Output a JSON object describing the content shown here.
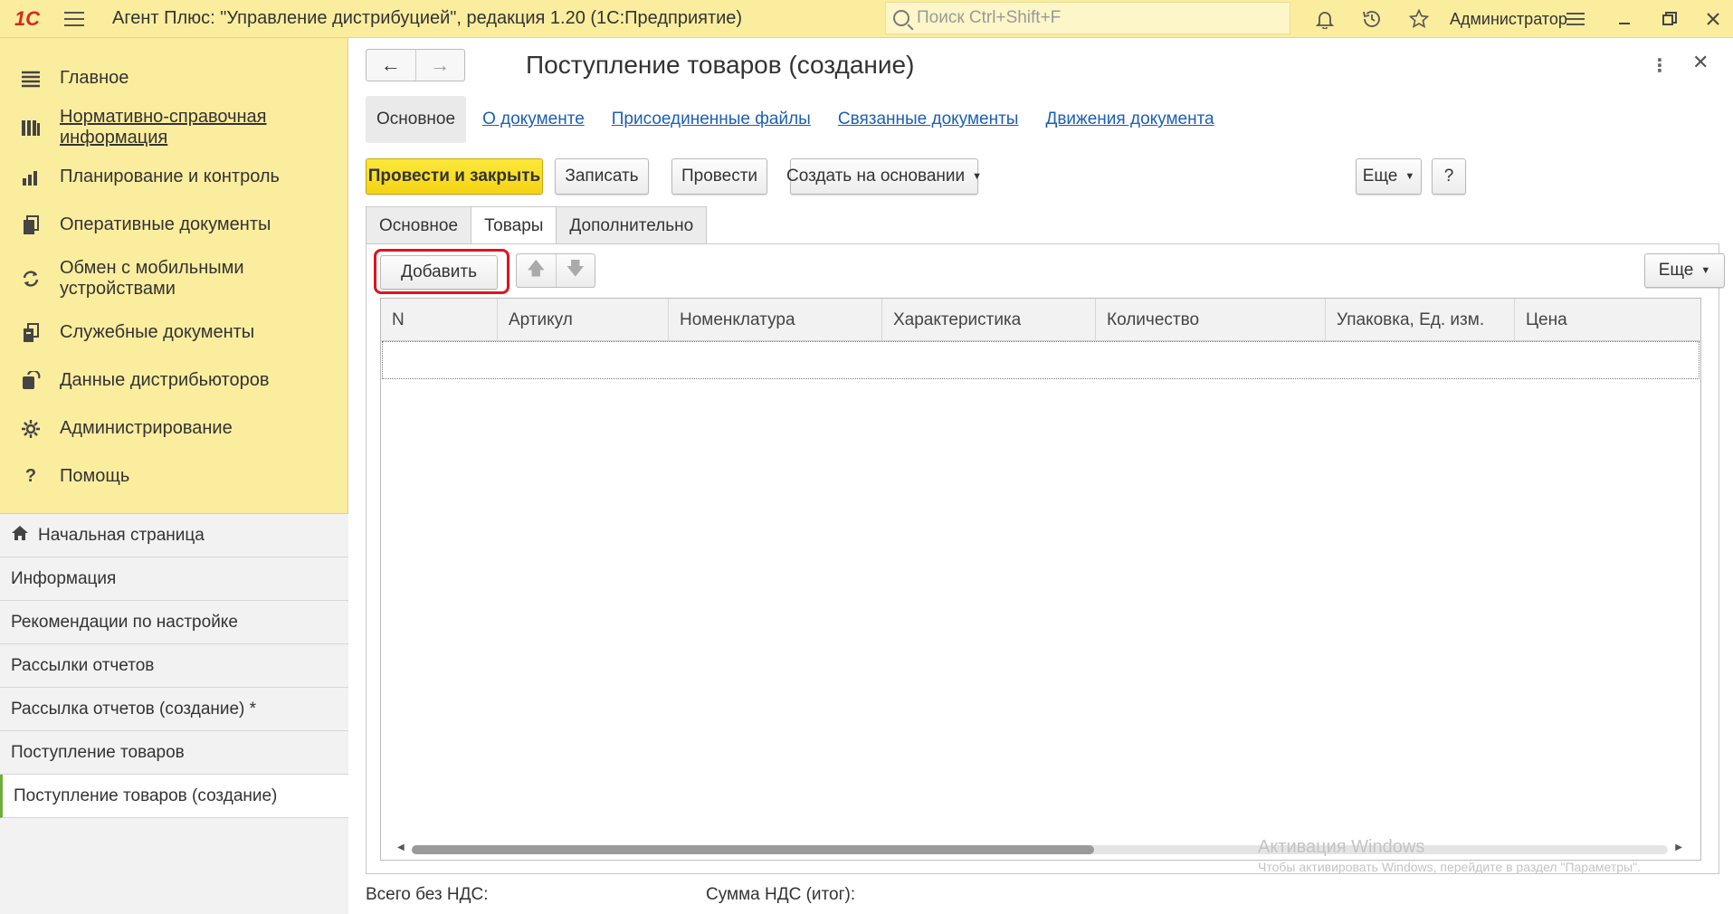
{
  "topbar": {
    "logo": "1С",
    "title": "Агент Плюс: \"Управление дистрибуцией\", редакция 1.20  (1С:Предприятие)",
    "search_placeholder": "Поиск Ctrl+Shift+F",
    "user": "Администратор"
  },
  "sidebar": {
    "items": [
      {
        "label": "Главное",
        "icon": "menu-lines-icon"
      },
      {
        "label": "Нормативно-справочная информация",
        "icon": "books-icon"
      },
      {
        "label": "Планирование и контроль",
        "icon": "bar-chart-icon"
      },
      {
        "label": "Оперативные документы",
        "icon": "documents-icon"
      },
      {
        "label": "Обмен с мобильными устройствами",
        "icon": "sync-icon"
      },
      {
        "label": "Служебные документы",
        "icon": "service-docs-icon"
      },
      {
        "label": "Данные дистрибьюторов",
        "icon": "distributor-data-icon"
      },
      {
        "label": "Администрирование",
        "icon": "gear-icon"
      },
      {
        "label": "Помощь",
        "icon": "question-icon"
      }
    ],
    "open_windows": [
      {
        "label": "Начальная страница",
        "icon": "home-icon"
      },
      {
        "label": "Информация"
      },
      {
        "label": "Рекомендации по настройке"
      },
      {
        "label": "Рассылки отчетов"
      },
      {
        "label": "Рассылка отчетов (создание) *"
      },
      {
        "label": "Поступление товаров"
      },
      {
        "label": "Поступление товаров (создание)",
        "active": true
      }
    ]
  },
  "document": {
    "title": "Поступление товаров (создание)",
    "sections": [
      "Основное",
      "О документе",
      "Присоединенные файлы",
      "Связанные документы",
      "Движения документа"
    ],
    "toolbar": {
      "post_close": "Провести и закрыть",
      "save": "Записать",
      "post": "Провести",
      "create_based": "Создать на основании",
      "more": "Еще",
      "help": "?"
    },
    "tabs": [
      "Основное",
      "Товары",
      "Дополнительно"
    ],
    "active_tab": "Товары",
    "table_toolbar": {
      "add": "Добавить",
      "more": "Еще"
    },
    "columns": [
      "N",
      "Артикул",
      "Номенклатура",
      "Характеристика",
      "Количество",
      "Упаковка, Ед. изм.",
      "Цена"
    ],
    "footer": {
      "total_no_vat": "Всего без НДС:",
      "vat_total": "Сумма НДС (итог):"
    }
  },
  "watermark": {
    "line1": "Активация Windows",
    "line2": "Чтобы активировать Windows, перейдите в раздел \"Параметры\"."
  },
  "colors": {
    "sidebar_bg": "#fbed9e",
    "primary_button": "#f4d314",
    "link": "#1c5fb5",
    "highlight": "#e0141c"
  }
}
